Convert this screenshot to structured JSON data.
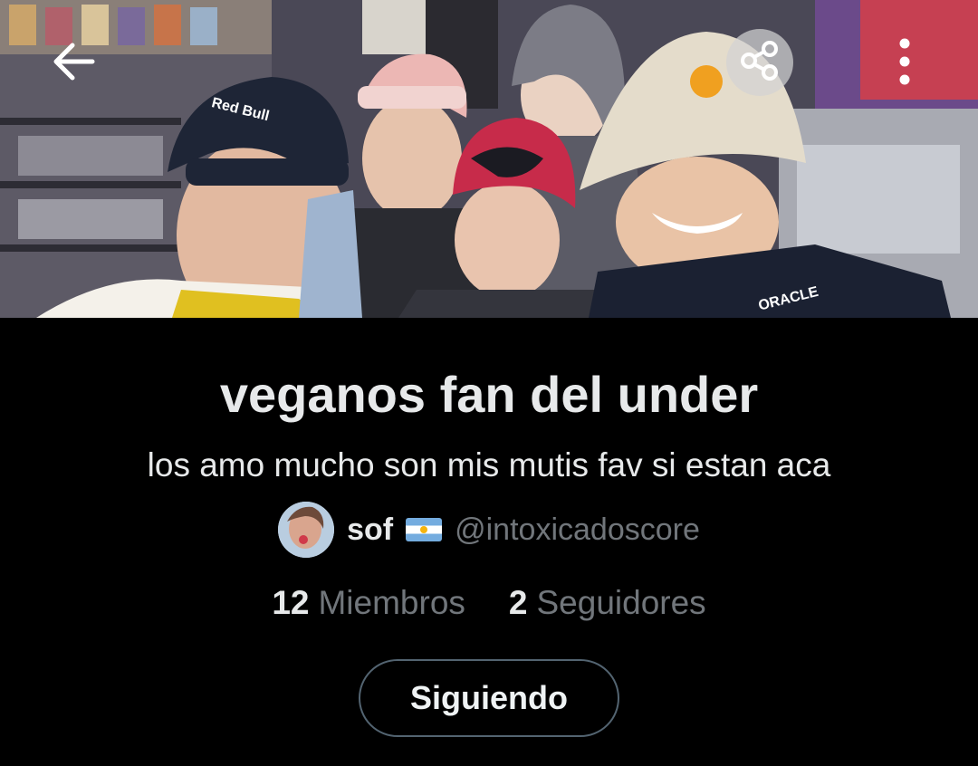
{
  "header": {
    "back_icon": "arrow-left-icon",
    "share_icon": "share-icon",
    "more_icon": "more-vertical-icon"
  },
  "community": {
    "title": "veganos fan del under",
    "description": "los amo mucho son mis mutis fav si estan aca",
    "owner": {
      "name": "sof",
      "flag": "🇦🇷",
      "handle": "@intoxicadoscore"
    },
    "stats": {
      "members_count": "12",
      "members_label": "Miembros",
      "followers_count": "2",
      "followers_label": "Seguidores"
    },
    "follow_button_label": "Siguiendo"
  },
  "colors": {
    "background": "#000000",
    "primary_text": "#e7e9ea",
    "secondary_text": "#71767b",
    "button_border": "#536471"
  }
}
